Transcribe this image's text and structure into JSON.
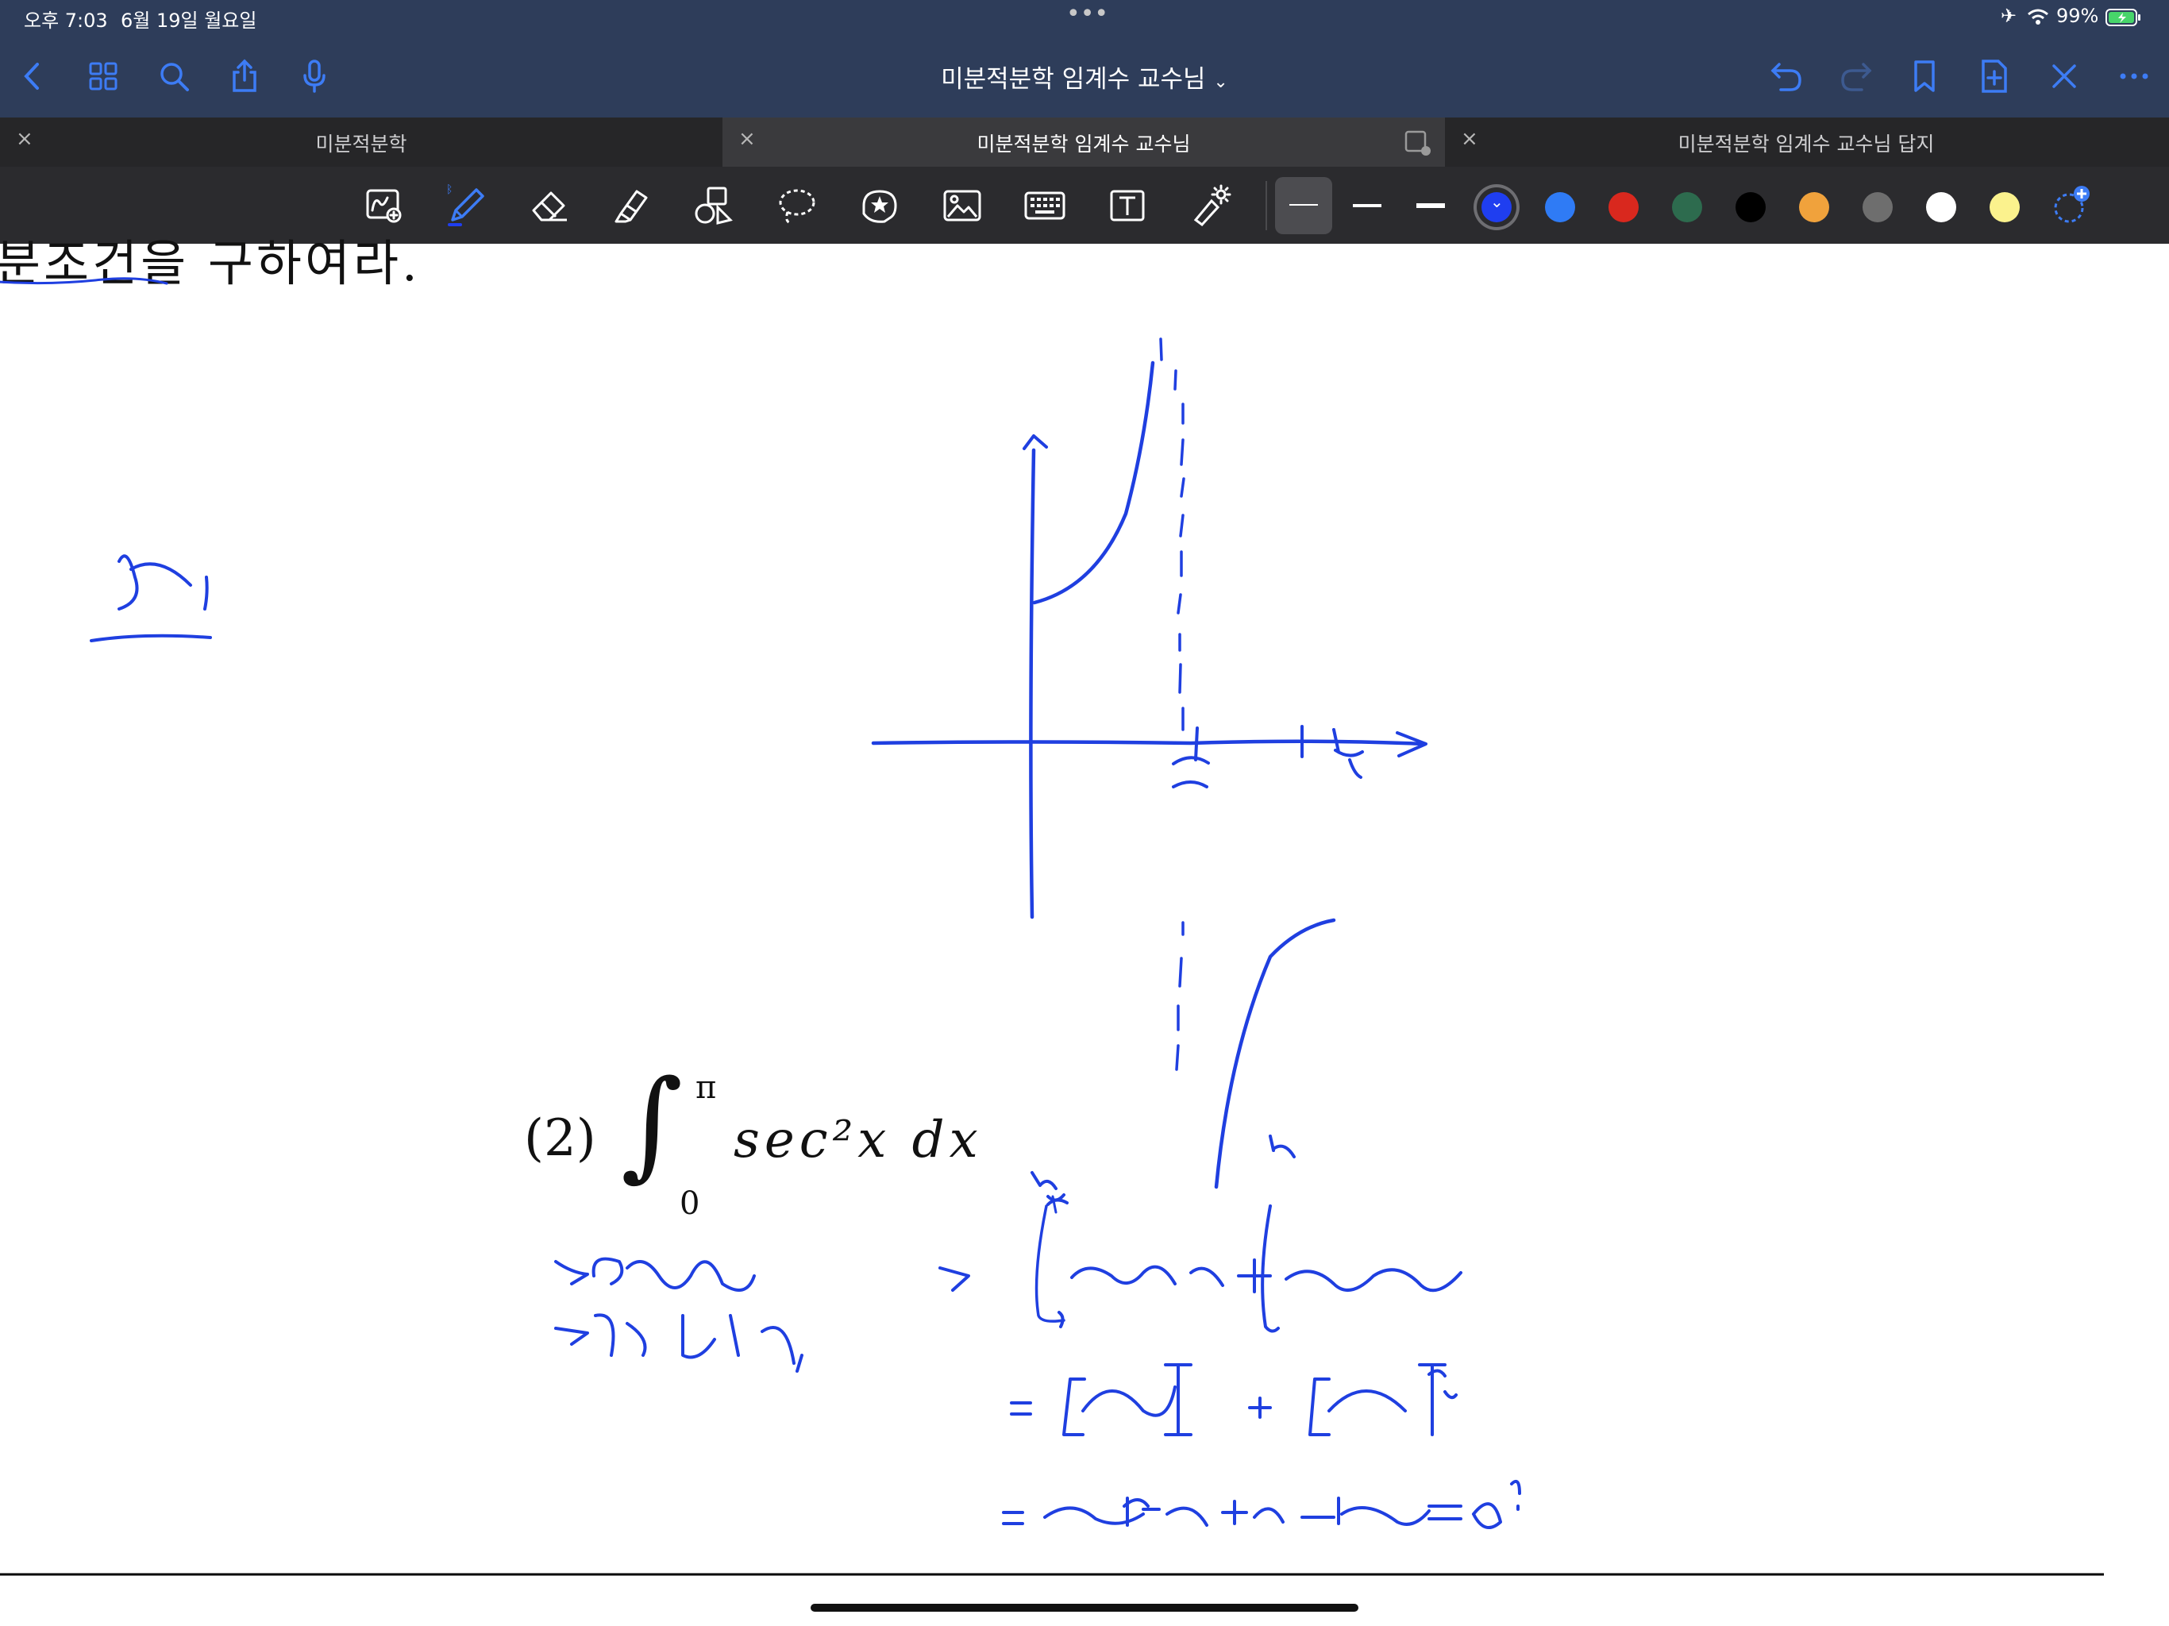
{
  "status": {
    "time": "오후 7:03",
    "date": "6월 19일 월요일",
    "battery": "99%",
    "dots": "•••"
  },
  "nav": {
    "title": "미분적분학 임계수 교수님",
    "left_icons": [
      "back-chevron-icon",
      "grid-icon",
      "search-icon",
      "share-icon",
      "microphone-icon"
    ],
    "right_icons": [
      "undo-icon",
      "redo-icon",
      "bookmark-icon",
      "add-page-icon",
      "close-pen-icon",
      "more-icon"
    ]
  },
  "tabs": [
    {
      "label": "미분적분학",
      "close": "×",
      "active": false
    },
    {
      "label": "미분적분학 임계수 교수님",
      "close": "×",
      "active": true
    },
    {
      "label": "미분적분학 임계수 교수님 답지",
      "close": "×",
      "active": false
    }
  ],
  "toolbar": {
    "tools": [
      "shape-magic-icon",
      "pen-icon",
      "eraser-icon",
      "highlighter-icon",
      "shapes-icon",
      "lasso-icon",
      "sticker-icon",
      "image-icon",
      "keyboard-icon",
      "text-box-icon",
      "laser-pointer-icon"
    ],
    "stroke_widths": [
      "thin",
      "medium",
      "thick"
    ],
    "colors": [
      "#1f3ef0",
      "#2f7bf5",
      "#d9281e",
      "#2d6b4e",
      "#000000",
      "#f0a23c",
      "#6e6e6e",
      "#ffffff",
      "#fbf28d"
    ],
    "selected_color": "#1f3ef0",
    "ink_color": "#1f3fe0"
  },
  "page": {
    "cut_text": "분조건을 구하여라.",
    "problem_number": "(2)",
    "integral_upper": "π",
    "integral_lower": "0",
    "integrand": "sec²x dx"
  }
}
